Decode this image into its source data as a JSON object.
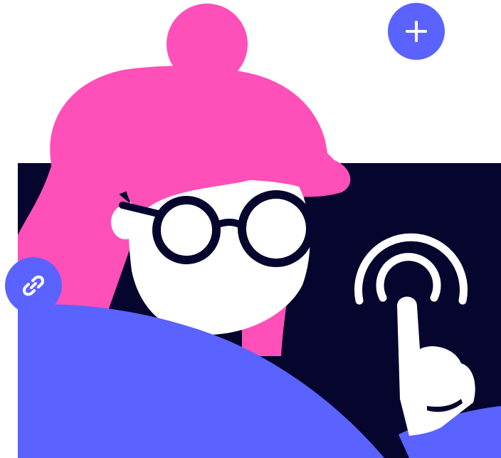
{
  "colors": {
    "background": "#ffffff",
    "dark_panel": "#05052e",
    "hair_pink": "#ff4fb8",
    "skin_white": "#ffffff",
    "glasses_dark": "#05052e",
    "shirt_blue": "#5a63ff",
    "button_blue": "#5a63ff",
    "icon_white": "#ffffff"
  },
  "buttons": {
    "add": {
      "icon": "plus-icon"
    },
    "link": {
      "icon": "link-icon"
    }
  },
  "illustration": {
    "subject": "person-with-pink-hair-and-glasses",
    "gesture_icon": "tap-gesture-icon"
  }
}
